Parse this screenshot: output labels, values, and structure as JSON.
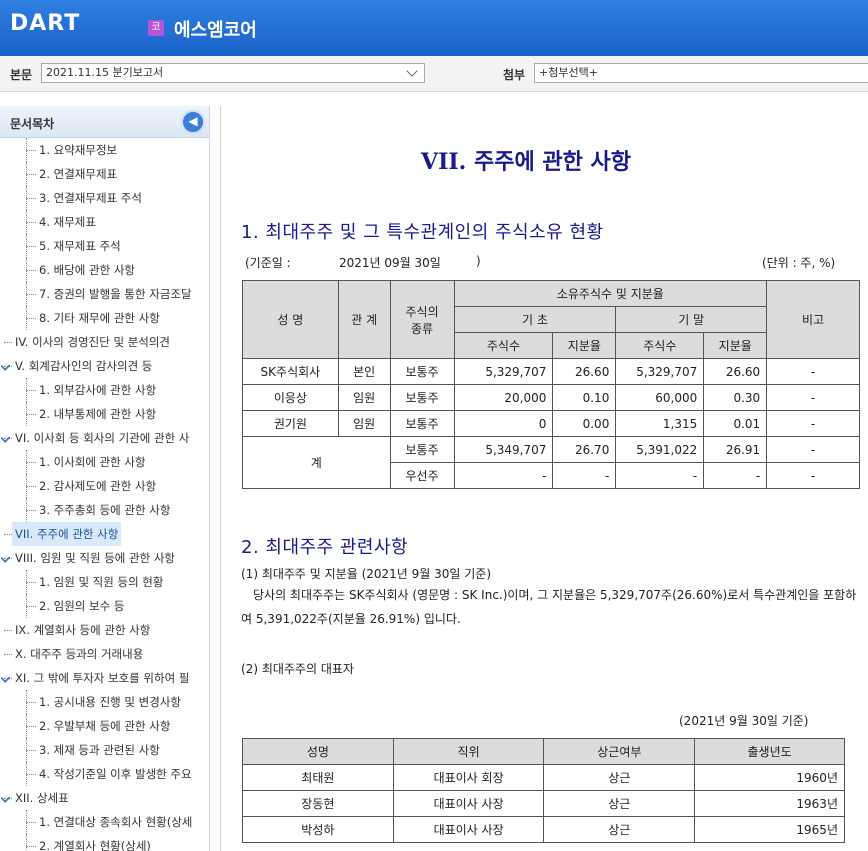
{
  "header": {
    "logo": "DART",
    "company_badge": "코",
    "company_name": "에스엠코어"
  },
  "toolbar": {
    "main_label": "본문",
    "main_select": "2021.11.15  분기보고서",
    "attach_label": "첨부",
    "attach_select": "+첨부선택+"
  },
  "sidebar": {
    "title": "문서목차",
    "items": [
      {
        "label": "1. 요약재무정보",
        "level": 2
      },
      {
        "label": "2. 연결재무제표",
        "level": 2
      },
      {
        "label": "3. 연결재무제표 주석",
        "level": 2
      },
      {
        "label": "4. 재무제표",
        "level": 2
      },
      {
        "label": "5. 재무제표 주석",
        "level": 2
      },
      {
        "label": "6. 배당에 관한 사항",
        "level": 2
      },
      {
        "label": "7. 증권의 발행을 통한 자금조달",
        "level": 2
      },
      {
        "label": "8. 기타 재무에 관한 사항",
        "level": 2
      },
      {
        "label": "IV. 이사의 경영진단 및 분석의견",
        "level": 1
      },
      {
        "label": "V. 회계감사인의 감사의견 등",
        "level": 1,
        "checked": true
      },
      {
        "label": "1. 외부감사에 관한 사항",
        "level": 2
      },
      {
        "label": "2. 내부통제에 관한 사항",
        "level": 2
      },
      {
        "label": "VI. 이사회 등 회사의 기관에 관한 사",
        "level": 1,
        "checked": true
      },
      {
        "label": "1. 이사회에 관한 사항",
        "level": 2
      },
      {
        "label": "2. 감사제도에 관한 사항",
        "level": 2
      },
      {
        "label": "3. 주주총회 등에 관한 사항",
        "level": 2
      },
      {
        "label": "VII. 주주에 관한 사항",
        "level": 1,
        "active": true
      },
      {
        "label": "VIII. 임원 및 직원 등에 관한 사항",
        "level": 1,
        "checked": true
      },
      {
        "label": "1. 임원 및 직원 등의 현황",
        "level": 2
      },
      {
        "label": "2. 임원의 보수 등",
        "level": 2
      },
      {
        "label": "IX. 계열회사 등에 관한 사항",
        "level": 1
      },
      {
        "label": "X. 대주주 등과의 거래내용",
        "level": 1
      },
      {
        "label": "XI. 그 밖에 투자자 보호를 위하여 필",
        "level": 1,
        "checked": true
      },
      {
        "label": "1. 공시내용 진행 및 변경사항",
        "level": 2
      },
      {
        "label": "2. 우발부채 등에 관한 사항",
        "level": 2
      },
      {
        "label": "3. 제재 등과 관련된 사항",
        "level": 2
      },
      {
        "label": "4. 작성기준일 이후 발생한 주요",
        "level": 2
      },
      {
        "label": "XII. 상세표",
        "level": 1,
        "checked": true
      },
      {
        "label": "1. 연결대상 종속회사 현황(상세",
        "level": 2
      },
      {
        "label": "2. 계열회사 현황(상세)",
        "level": 2
      }
    ]
  },
  "content": {
    "title": "VII. 주주에 관한 사항",
    "section1": {
      "heading": "1. 최대주주 및 그 특수관계인의 주식소유 현황",
      "date_label": "(기준일 :",
      "date_value": "2021년 09월 30일",
      "date_close": ")",
      "unit": "(단위 : 주, %)",
      "headers": {
        "name": "성 명",
        "relation": "관 계",
        "stock_type": "주식의 종류",
        "ownership": "소유주식수 및 지분율",
        "begin": "기 초",
        "end": "기 말",
        "shares": "주식수",
        "ratio": "지분율",
        "note": "비고"
      },
      "rows": [
        {
          "name": "SK주식회사",
          "relation": "본인",
          "type": "보통주",
          "b_shares": "5,329,707",
          "b_ratio": "26.60",
          "e_shares": "5,329,707",
          "e_ratio": "26.60",
          "note": "-"
        },
        {
          "name": "이응상",
          "relation": "임원",
          "type": "보통주",
          "b_shares": "20,000",
          "b_ratio": "0.10",
          "e_shares": "60,000",
          "e_ratio": "0.30",
          "note": "-"
        },
        {
          "name": "권기원",
          "relation": "임원",
          "type": "보통주",
          "b_shares": "0",
          "b_ratio": "0.00",
          "e_shares": "1,315",
          "e_ratio": "0.01",
          "note": "-"
        }
      ],
      "total_label": "계",
      "total_rows": [
        {
          "type": "보통주",
          "b_shares": "5,349,707",
          "b_ratio": "26.70",
          "e_shares": "5,391,022",
          "e_ratio": "26.91",
          "note": "-"
        },
        {
          "type": "우선주",
          "b_shares": "-",
          "b_ratio": "-",
          "e_shares": "-",
          "e_ratio": "-",
          "note": "-"
        }
      ]
    },
    "section2": {
      "heading": "2. 최대주주 관련사항",
      "sub1": "(1) 최대주주 및 지분율 (2021년 9월 30일 기준)",
      "para": "당사의 최대주주는 SK주식회사 (영문명 : SK Inc.)이며, 그 지분율은 5,329,707주(26.60%)로서 특수관계인을 포함하여 5,391,022주(지분율 26.91%) 입니다.",
      "sub2": "(2)  최대주주의 대표자",
      "asof": "(2021년 9월 30일 기준)",
      "rep_headers": [
        "성명",
        "직위",
        "상근여부",
        "출생년도"
      ],
      "rep_rows": [
        [
          "최태원",
          "대표이사 회장",
          "상근",
          "1960년"
        ],
        [
          "장동현",
          "대표이사 사장",
          "상근",
          "1963년"
        ],
        [
          "박성하",
          "대표이사 사장",
          "상근",
          "1965년"
        ]
      ]
    }
  }
}
